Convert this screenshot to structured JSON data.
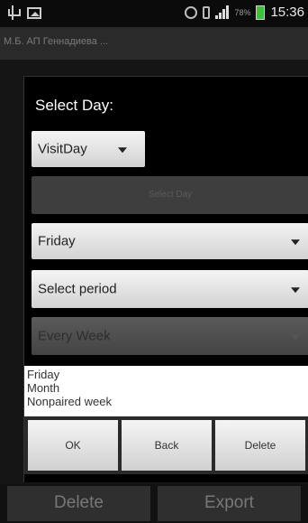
{
  "status_bar": {
    "time": "15:36",
    "battery_percent": "78%",
    "battery_color": "#3fbf3f",
    "icons": [
      "usb-icon",
      "image-icon",
      "alarm-icon",
      "vibrate-icon",
      "signal-icon",
      "battery-icon"
    ]
  },
  "background": {
    "title": "М.Б. АП Геннадиева ...",
    "footer_buttons": [
      "Delete",
      "Export"
    ]
  },
  "dialog": {
    "title": "Select Day:",
    "visit_day_spinner": "VisitDay",
    "select_day_button": "Select Day",
    "day_spinner": "Friday",
    "period_spinner": "Select period",
    "week_spinner": "Every Week",
    "summary_lines": [
      "Friday",
      "Month",
      "Nonpaired week"
    ],
    "buttons": {
      "ok": "OK",
      "back": "Back",
      "delete": "Delete"
    }
  }
}
